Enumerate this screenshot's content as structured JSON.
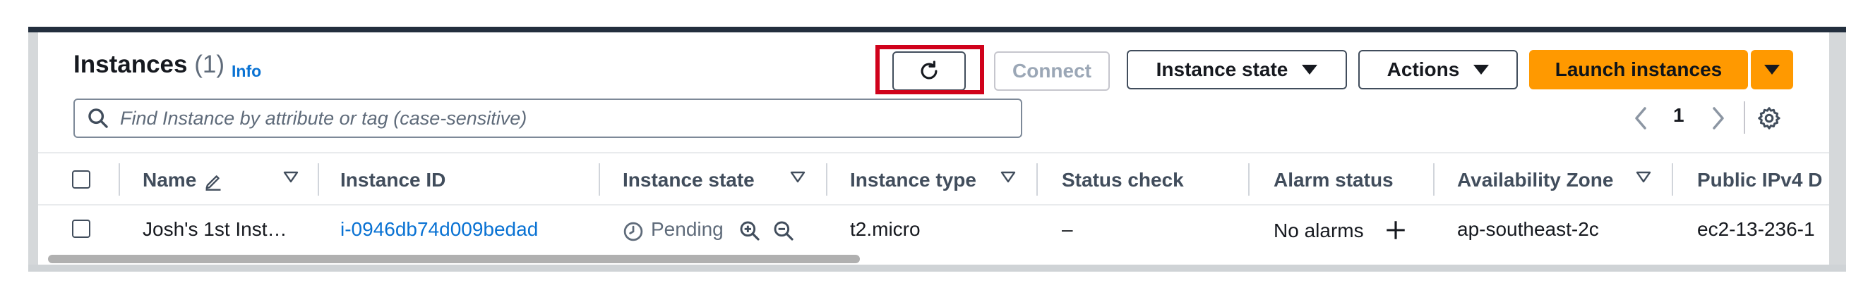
{
  "header": {
    "title": "Instances",
    "count": "(1)",
    "info_label": "Info"
  },
  "toolbar": {
    "refresh_icon": "refresh-icon",
    "connect_label": "Connect",
    "instance_state_label": "Instance state",
    "actions_label": "Actions",
    "launch_label": "Launch instances"
  },
  "search": {
    "placeholder": "Find Instance by attribute or tag (case-sensitive)",
    "value": ""
  },
  "pagination": {
    "current_page": "1"
  },
  "columns": {
    "name": "Name",
    "instance_id": "Instance ID",
    "instance_state": "Instance state",
    "instance_type": "Instance type",
    "status_check": "Status check",
    "alarm_status": "Alarm status",
    "availability_zone": "Availability Zone",
    "public_ipv4": "Public IPv4 D"
  },
  "rows": [
    {
      "name": "Josh's 1st Inst…",
      "instance_id": "i-0946db74d009bedad",
      "state": "Pending",
      "type": "t2.micro",
      "status_check": "–",
      "alarm_status": "No alarms",
      "availability_zone": "ap-southeast-2c",
      "public_ipv4": "ec2-13-236-1"
    }
  ],
  "colors": {
    "accent": "#ff9900",
    "link": "#0972d3",
    "highlight": "#d0021b",
    "top_bar": "#232f3e"
  }
}
